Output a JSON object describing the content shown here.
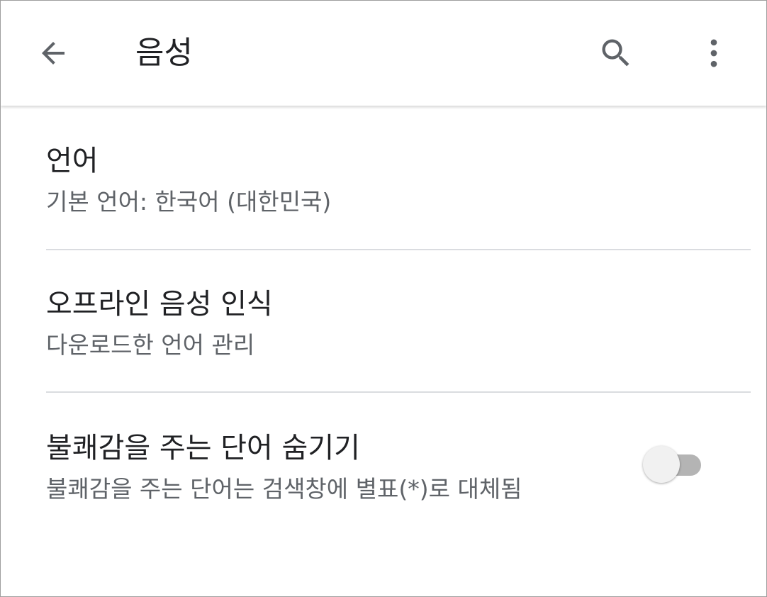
{
  "appbar": {
    "title": "음성",
    "back_icon": "arrow-back-icon",
    "search_icon": "search-icon",
    "more_icon": "more-vert-icon",
    "icon_color": "#5f6368"
  },
  "settings": [
    {
      "title": "언어",
      "subtitle": "기본 언어: 한국어 (대한민국)"
    },
    {
      "title": "오프라인 음성 인식",
      "subtitle": "다운로드한 언어 관리"
    },
    {
      "title": "불쾌감을 주는 단어 숨기기",
      "subtitle": "불쾌감을 주는 단어는 검색창에 별표(*)로 대체됨",
      "toggle_on": false
    }
  ],
  "colors": {
    "title_text": "#202124",
    "subtitle_text": "#5f6368",
    "divider": "#dadce0",
    "toggle_track_off": "#b4b4b4",
    "toggle_thumb_off": "#f1f1f1"
  }
}
